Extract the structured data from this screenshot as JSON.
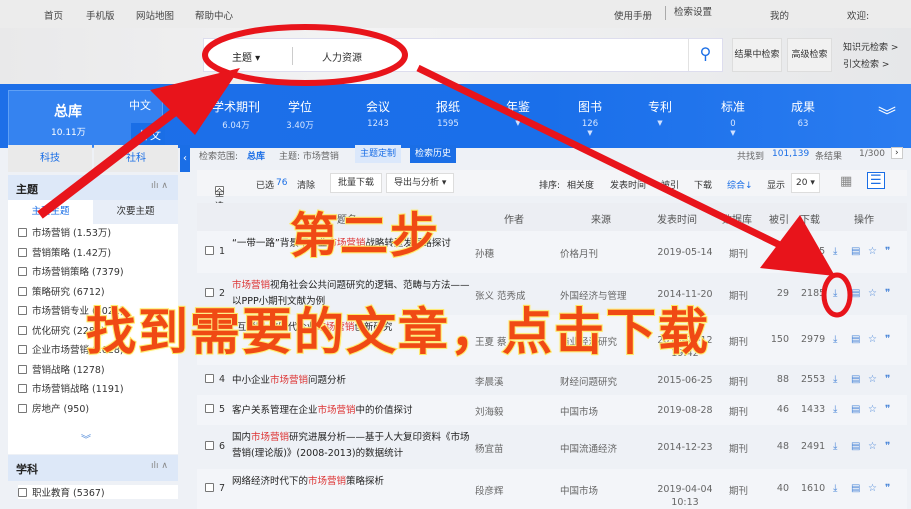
{
  "topbar": {
    "home": "首页",
    "mobile": "手机版",
    "sitemap": "网站地图",
    "help": "帮助中心",
    "manual": "使用手册",
    "settings": "检索设置",
    "mine": "我的",
    "welcome": "欢迎:"
  },
  "search": {
    "field": "主题",
    "value": "人力资源",
    "in_results": "结果中检索",
    "advanced": "高级检索",
    "knowledge": "知识元检索 >",
    "citation": "引文检索 >"
  },
  "nav": {
    "main": {
      "label": "总库",
      "count": "10.11万",
      "zh": "中文",
      "foreign": "外文"
    },
    "items": [
      {
        "label": "学术期刊",
        "count": "6.04万"
      },
      {
        "label": "学位",
        "count": "3.40万"
      },
      {
        "label": "会议",
        "count": "1243"
      },
      {
        "label": "报纸",
        "count": "1595"
      },
      {
        "label": "年鉴",
        "count": ""
      },
      {
        "label": "图书",
        "count": "126"
      },
      {
        "label": "专利",
        "count": ""
      },
      {
        "label": "标准",
        "count": "0"
      },
      {
        "label": "成果",
        "count": "63"
      }
    ]
  },
  "sidebar": {
    "tabs": [
      "科技",
      "社科"
    ],
    "topic_title": "主题",
    "subtabs": [
      "主要主题",
      "次要主题"
    ],
    "topics": [
      "市场营销 (1.53万)",
      "营销策略 (1.42万)",
      "市场营销策略 (7379)",
      "策略研究 (6712)",
      "市场营销专业 (3021)",
      "优化研究 (2289)",
      "企业市场营销 (1628)",
      "营销战略 (1278)",
      "市场营销战略 (1191)",
      "房地产 (950)"
    ],
    "subject_title": "学科",
    "subjects": [
      "职业教育 (5367)"
    ]
  },
  "main": {
    "scope_label": "检索范围:",
    "scope_value": "总库",
    "topic_label": "主题: 市场营销",
    "topic_custom": "主题定制",
    "history": "检索历史",
    "found_prefix": "共找到",
    "found_count": "101,139",
    "found_suffix": "条结果",
    "page": "1/300",
    "toolbar": {
      "select_all": "全选",
      "selected_label": "已选",
      "selected_count": "76",
      "clear": "清除",
      "batch_download": "批量下载",
      "export": "导出与分析 ▾",
      "sort_label": "排序:",
      "sort_relevance": "相关度",
      "sort_date": "发表时间",
      "sort_cited": "被引",
      "sort_download": "下载",
      "sort_overall": "综合↓",
      "show_label": "显示",
      "page_size": "20 ▾"
    },
    "headers": {
      "title": "题名",
      "author": "作者",
      "source": "来源",
      "date": "发表时间",
      "db": "数据库",
      "cited": "被引",
      "download": "下载",
      "ops": "操作"
    },
    "rows": [
      {
        "num": "1",
        "pre": "“一带一路”背景下企业",
        "hl": "市场营销",
        "post": "战略转型发展路探讨",
        "author": "孙穗",
        "source": "价格月刊",
        "date": "2019-05-14",
        "db": "期刊",
        "cited": "",
        "downloads": "1425"
      },
      {
        "num": "2",
        "pre": "",
        "hl": "市场营销",
        "post": "视角社会公共问题研究的逻辑、范畴与方法——以PPP小期刊文献为例",
        "author": "张义 范秀成",
        "source": "外国经济与管理",
        "date": "2014-11-20",
        "db": "期刊",
        "cited": "29",
        "downloads": "2185"
      },
      {
        "num": "3",
        "pre": "“互联网+”时代企业",
        "hl": "市场营销",
        "post": "创新研究",
        "author": "王夏 蔡",
        "source": "商业经济研究",
        "date": "2019-05-12 19:42",
        "db": "期刊",
        "cited": "150",
        "downloads": "2979"
      },
      {
        "num": "4",
        "pre": "中小企业",
        "hl": "市场营销",
        "post": "问题分析",
        "author": "李晨溪",
        "source": "财经问题研究",
        "date": "2015-06-25",
        "db": "期刊",
        "cited": "88",
        "downloads": "2553"
      },
      {
        "num": "5",
        "pre": "客户关系管理在企业",
        "hl": "市场营销",
        "post": "中的价值探讨",
        "author": "刘海毅",
        "source": "中国市场",
        "date": "2019-08-28",
        "db": "期刊",
        "cited": "46",
        "downloads": "1433"
      },
      {
        "num": "6",
        "pre": "国内",
        "hl": "市场营销",
        "post": "研究进展分析——基于人大复印资料《市场营销(理论版)》(2008-2013)的数据统计",
        "author": "杨宜苗",
        "source": "中国流通经济",
        "date": "2014-12-23",
        "db": "期刊",
        "cited": "48",
        "downloads": "2491"
      },
      {
        "num": "7",
        "pre": "网络经济时代下的",
        "hl": "市场营销",
        "post": "策略探析",
        "author": "段彦辉",
        "source": "中国市场",
        "date": "2019-04-04 10:13",
        "db": "期刊",
        "cited": "40",
        "downloads": "1610"
      }
    ]
  },
  "annotation": {
    "step": "第二步",
    "instruction": "找到需要的文章，点击下载",
    "color": "#f04a14"
  }
}
